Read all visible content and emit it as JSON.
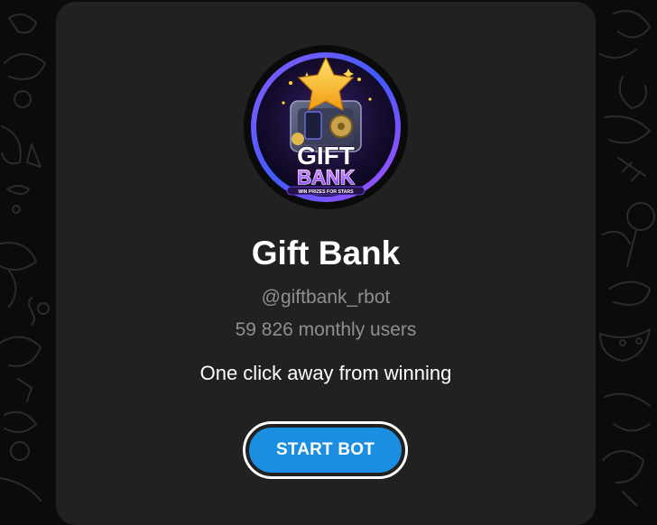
{
  "bot": {
    "name": "Gift Bank",
    "username": "@giftbank_rbot",
    "monthly_users": "59 826 monthly users",
    "description": "One click away from winning"
  },
  "avatar": {
    "line1": "GIFT",
    "line2": "BANK",
    "tagline": "WIN PRIZES FOR STARS"
  },
  "actions": {
    "start_label": "START BOT"
  },
  "colors": {
    "page_background": "#0b0b0b",
    "card_background": "#212121",
    "button_blue": "#1a8ee1",
    "secondary_text": "#8f8f8f"
  },
  "icons": [
    "gift-bank-logo",
    "doodle-pattern"
  ]
}
